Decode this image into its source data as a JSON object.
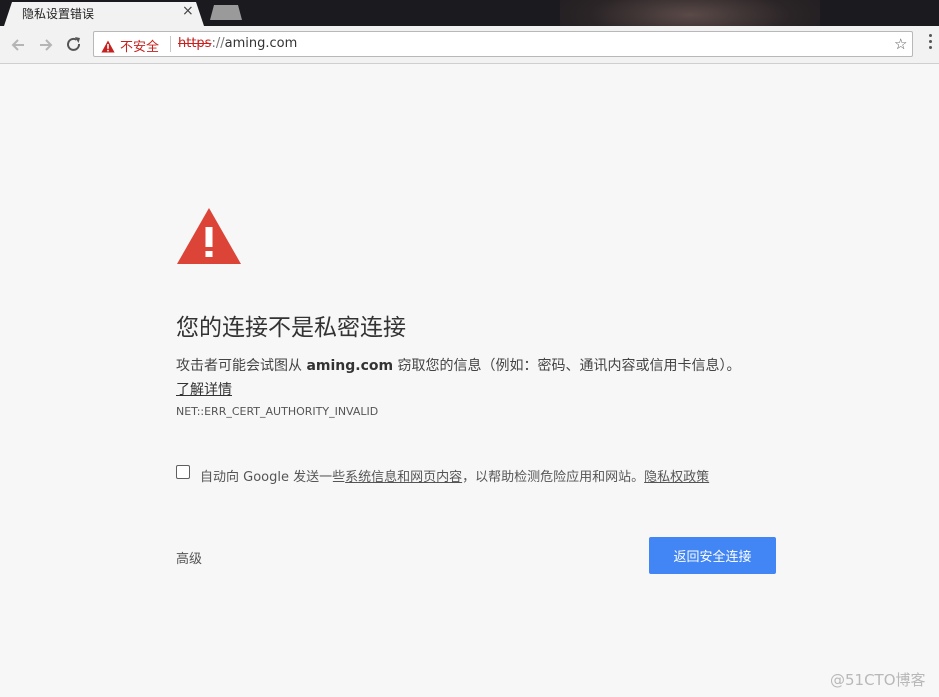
{
  "tab": {
    "title": "隐私设置错误",
    "close_glyph": "×"
  },
  "omnibox": {
    "security_label": "不安全",
    "url_scheme": "https",
    "url_separator": "://",
    "url_host": "aming.com",
    "bookmark_glyph": "☆"
  },
  "page": {
    "heading": "您的连接不是私密连接",
    "description_prefix": "攻击者可能会试图从 ",
    "description_host": "aming.com",
    "description_suffix": " 窃取您的信息（例如：密码、通讯内容或信用卡信息）。",
    "learn_more": "了解详情",
    "error_code": "NET::ERR_CERT_AUTHORITY_INVALID",
    "opt_in_prefix": "自动向 Google 发送一些",
    "opt_in_link": "系统信息和网页内容",
    "opt_in_middle": "，以帮助检测危险应用和网站。",
    "privacy_policy_link": "隐私权政策",
    "advanced_label": "高级",
    "back_to_safety_label": "返回安全连接"
  },
  "watermark": "@51CTO博客",
  "colors": {
    "warning_red": "#db4437",
    "primary_blue": "#4285f4",
    "insecure_red": "#c5221f",
    "page_background": "#f7f7f7"
  },
  "icons": {
    "back": "back-arrow-icon",
    "forward": "forward-arrow-icon",
    "reload": "reload-icon",
    "warning": "warning-triangle-icon",
    "bookmark": "star-icon",
    "menu": "more-vertical-icon"
  }
}
